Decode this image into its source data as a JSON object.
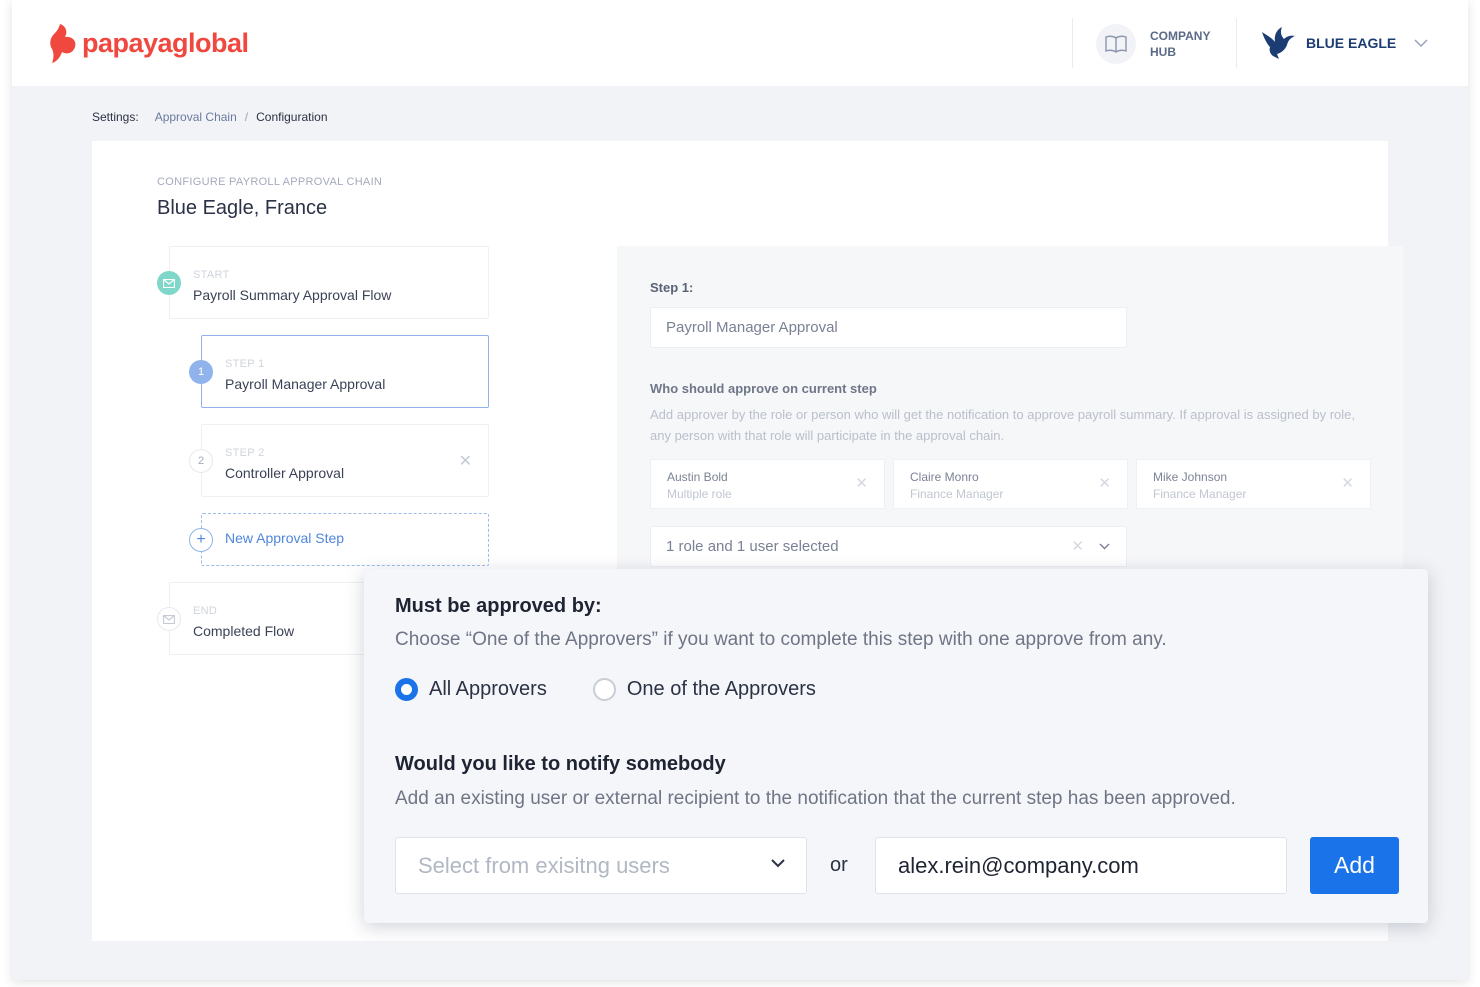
{
  "header": {
    "logo_text": "papayaglobal",
    "company_hub_line1": "COMPANY",
    "company_hub_line2": "HUB",
    "company_name": "BLUE EAGLE",
    "accent_color": "#f0483e"
  },
  "breadcrumb": {
    "label": "Settings:",
    "link": "Approval Chain",
    "separator": "/",
    "current": "Configuration"
  },
  "card": {
    "subtitle": "CONFIGURE PAYROLL APPROVAL CHAIN",
    "title": "Blue Eagle, France"
  },
  "steps": {
    "start": {
      "small": "START",
      "label": "Payroll Summary Approval Flow"
    },
    "step1": {
      "small": "STEP 1",
      "label": "Payroll Manager Approval",
      "number": "1"
    },
    "step2": {
      "small": "STEP 2",
      "label": "Controller Approval",
      "number": "2"
    },
    "new_step": {
      "label": "New Approval Step"
    },
    "end": {
      "small": "END",
      "label": "Completed Flow"
    }
  },
  "config": {
    "step_heading": "Step 1:",
    "step_name_value": "Payroll Manager Approval",
    "who_heading": "Who should approve on current step",
    "who_description": "Add approver by the role or person who will get the notification to approve payroll summary. If approval is assigned by role, any person with that role will participate in the approval chain.",
    "approvers": [
      {
        "name": "Austin Bold",
        "role": "Multiple role"
      },
      {
        "name": "Claire Monro",
        "role": "Finance Manager"
      },
      {
        "name": "Mike Johnson",
        "role": "Finance Manager"
      }
    ],
    "selection_summary": "1 role and 1 user selected"
  },
  "modal": {
    "approved_by_title": "Must be approved by:",
    "approved_by_desc": "Choose “One of the Approvers” if you want to complete this step with one approve from any.",
    "options": [
      {
        "label": "All Approvers",
        "selected": true
      },
      {
        "label": "One of the Approvers",
        "selected": false
      }
    ],
    "notify_title": "Would you like to notify somebody",
    "notify_desc": "Add an existing user or external recipient to the notification that the current step has been approved.",
    "select_placeholder": "Select from exisitng users",
    "or_text": "or",
    "email_value": "alex.rein@company.com",
    "add_label": "Add",
    "primary_color": "#1a73e8"
  }
}
